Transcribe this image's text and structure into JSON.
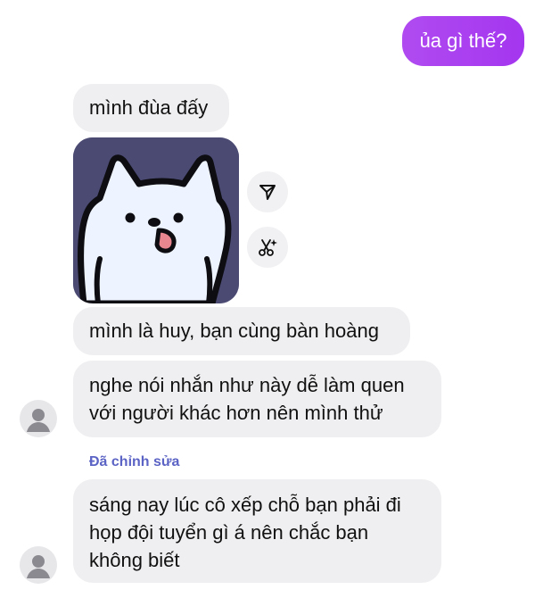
{
  "messages": {
    "m1_out": "ủa gì thế?",
    "m2_in": "mình đùa đấy",
    "m3_in": "mình là huy, bạn cùng bàn hoàng",
    "m4_in_line1": "nghe nói nhắn như này dễ làm quen",
    "m4_in_line2": "với người khác hơn nên mình thử",
    "edited_label": "Đã chỉnh sửa",
    "m5_in_line1": "sáng nay lúc cô xếp chỗ bạn phải đi",
    "m5_in_line2": "họp đội tuyển gì á nên chắc bạn",
    "m5_in_line3": "không biết"
  },
  "icons": {
    "forward": "send-forward-icon",
    "remix": "scissors-sparkle-icon",
    "avatar": "default-user-avatar",
    "sticker": "white-cat-sticker"
  },
  "colors": {
    "outgoing_bubble": "#a534f2",
    "incoming_bubble": "#efeff1",
    "edited_label": "#5b63c4",
    "sticker_background": "#4b4a73"
  }
}
